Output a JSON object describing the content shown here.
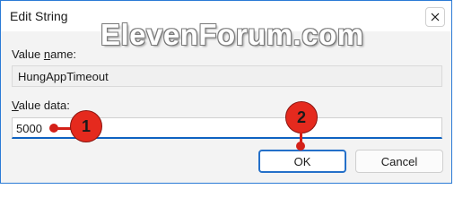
{
  "window": {
    "title": "Edit String"
  },
  "watermark": "ElevenForum.com",
  "value_name": {
    "label_prefix": "Value ",
    "label_underlined": "n",
    "label_suffix": "ame:",
    "value": "HungAppTimeout"
  },
  "value_data": {
    "label_underlined": "V",
    "label_suffix": "alue data:",
    "value": "5000"
  },
  "buttons": {
    "ok": "OK",
    "cancel": "Cancel"
  },
  "callouts": [
    "1",
    "2"
  ],
  "colors": {
    "accent": "#0f62c2",
    "callout": "#e52a1e",
    "window_border": "#2b7bd6"
  }
}
